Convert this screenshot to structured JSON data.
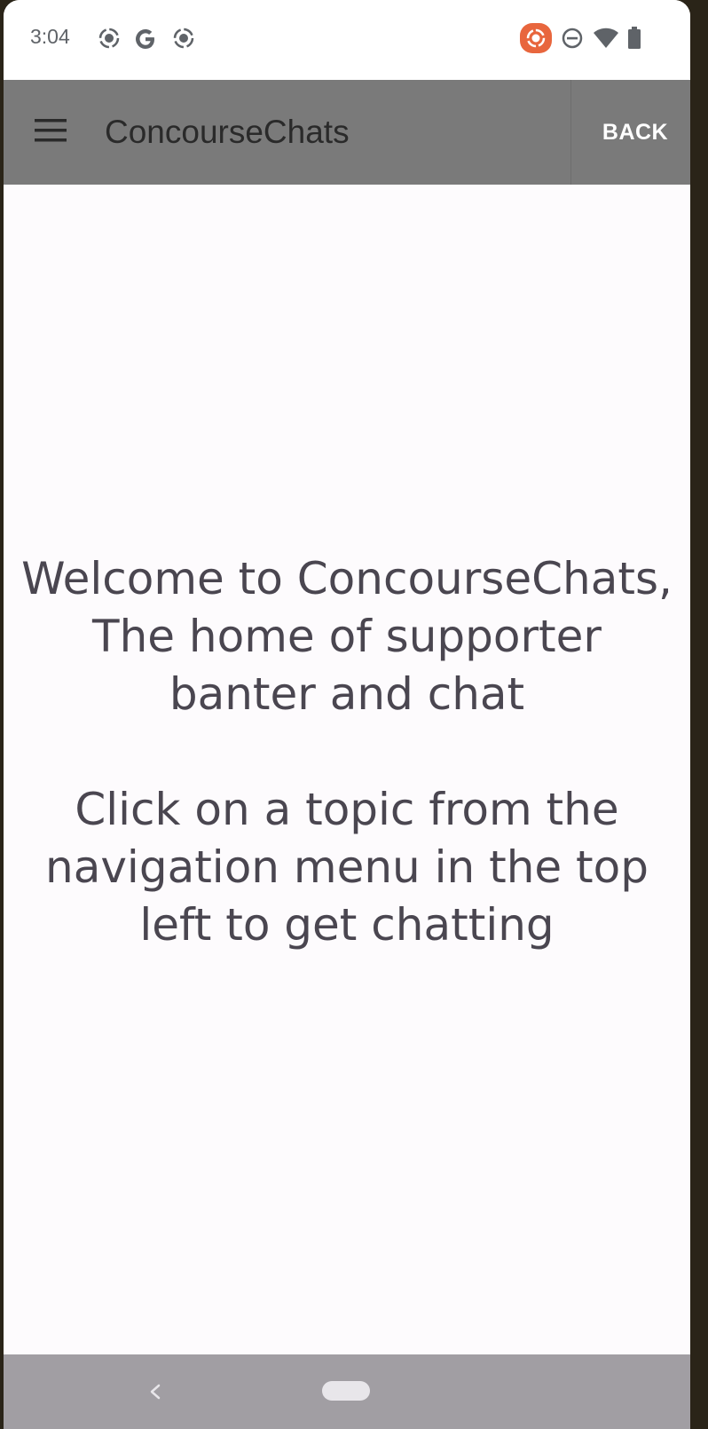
{
  "status_bar": {
    "time": "3:04",
    "icons": [
      "record-icon",
      "google-icon",
      "record-icon",
      "screen-record-icon",
      "do-not-disturb-icon",
      "wifi-icon",
      "battery-icon"
    ],
    "accent_color": "#e8663d"
  },
  "app_bar": {
    "title": "ConcourseChats",
    "back_label": "BACK",
    "background": "#7a7a7a"
  },
  "main": {
    "welcome_line": "Welcome to ConcourseChats, The home of supporter banter and chat",
    "instruction_line": "Click on a topic from the navigation menu in the top left to get chatting"
  },
  "nav_bar": {
    "icons": [
      "nav-back-icon",
      "nav-home-pill"
    ]
  }
}
